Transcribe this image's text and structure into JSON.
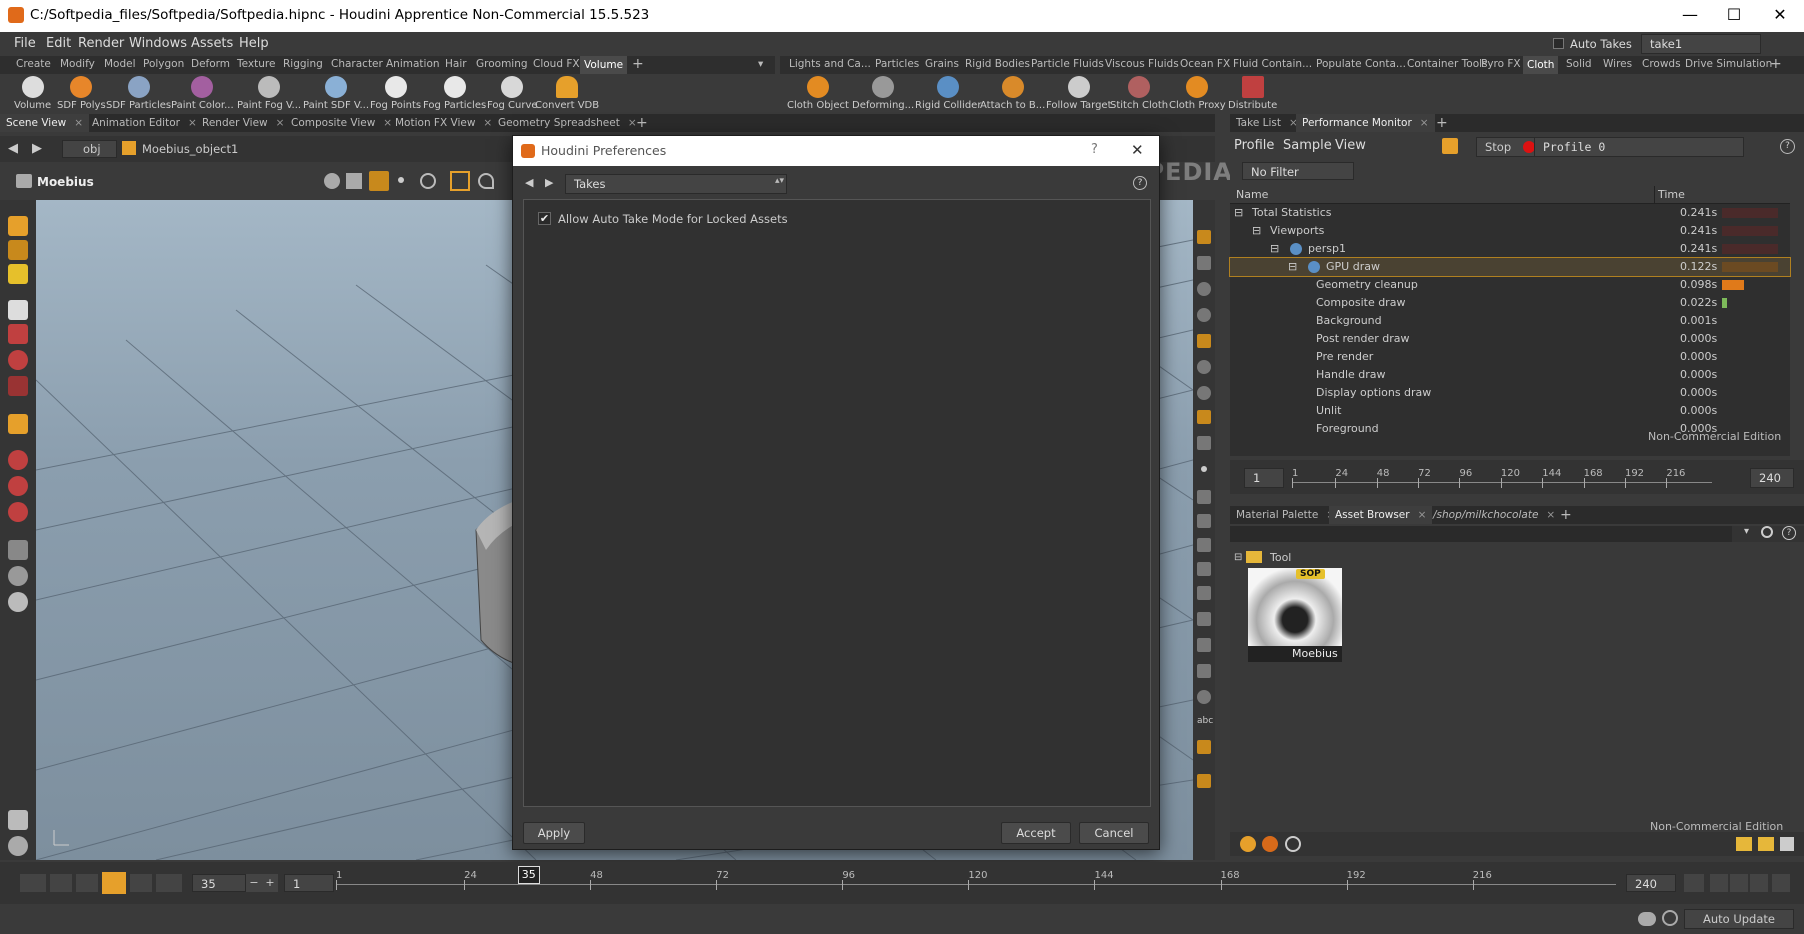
{
  "window": {
    "title": "C:/Softpedia_files/Softpedia/Softpedia.hipnc - Houdini Apprentice Non-Commercial 15.5.523",
    "min": "—",
    "max": "☐",
    "close": "✕"
  },
  "menu": [
    "File",
    "Edit",
    "Render",
    "Windows",
    "Assets",
    "Help"
  ],
  "auto_takes": {
    "label": "Auto Takes",
    "take": "take1"
  },
  "shelf_left_tabs": [
    "Create",
    "Modify",
    "Model",
    "Polygon",
    "Deform",
    "Texture",
    "Rigging",
    "Character",
    "Animation",
    "Hair",
    "Grooming",
    "Cloud FX",
    "Volume"
  ],
  "shelf_left_active": "Volume",
  "shelf_left_tools": [
    "Volume",
    "SDF Polys",
    "SDF Particles",
    "Paint Color...",
    "Paint Fog V...",
    "Paint SDF V...",
    "Fog Points",
    "Fog Particles",
    "Fog Curve",
    "Convert VDB"
  ],
  "shelf_right_tabs": [
    "Lights and Ca...",
    "Particles",
    "Grains",
    "Rigid Bodies",
    "Particle Fluids",
    "Viscous Fluids",
    "Ocean FX",
    "Fluid Contain...",
    "Populate Conta...",
    "Container Tools",
    "Pyro FX",
    "Cloth",
    "Solid",
    "Wires",
    "Crowds",
    "Drive Simulation"
  ],
  "shelf_right_active": "Cloth",
  "shelf_right_tools": [
    "Cloth Object",
    "Deforming...",
    "Rigid Collider",
    "Attach to B...",
    "Follow Target",
    "Stitch Cloth",
    "Cloth Proxy",
    "Distribute"
  ],
  "view_tabs": [
    "Scene View",
    "Animation Editor",
    "Render View",
    "Composite View",
    "Motion FX View",
    "Geometry Spreadsheet"
  ],
  "path": {
    "obj": "obj",
    "node": "Moebius_object1"
  },
  "viewport_label": "Moebius",
  "dialog": {
    "title": "Houdini Preferences",
    "help": "?",
    "close": "✕",
    "section": "Takes",
    "option": "Allow Auto Take Mode for Locked Assets",
    "apply": "Apply",
    "accept": "Accept",
    "cancel": "Cancel"
  },
  "right_tabs": [
    "Take List",
    "Performance Monitor"
  ],
  "perf": {
    "menus": [
      "Profile",
      "Sample",
      "View"
    ],
    "stop": "Stop",
    "profile": "Profile 0",
    "filter": "No Filter",
    "col_name": "Name",
    "col_time": "Time",
    "rows": [
      {
        "name": "Total Statistics",
        "time": "0.241s",
        "indent": 0,
        "bar": 0
      },
      {
        "name": "Viewports",
        "time": "0.241s",
        "indent": 1,
        "bar": 0
      },
      {
        "name": "persp1",
        "time": "0.241s",
        "indent": 2,
        "bar": 0
      },
      {
        "name": "GPU draw",
        "time": "0.122s",
        "indent": 3,
        "bar": 0,
        "sel": true
      },
      {
        "name": "Geometry cleanup",
        "time": "0.098s",
        "indent": 4,
        "bar": 0.4
      },
      {
        "name": "Composite draw",
        "time": "0.022s",
        "indent": 4,
        "bar": 0.09
      },
      {
        "name": "Background",
        "time": "0.001s",
        "indent": 4,
        "bar": 0
      },
      {
        "name": "Post render draw",
        "time": "0.000s",
        "indent": 4,
        "bar": 0
      },
      {
        "name": "Pre render",
        "time": "0.000s",
        "indent": 4,
        "bar": 0
      },
      {
        "name": "Handle draw",
        "time": "0.000s",
        "indent": 4,
        "bar": 0
      },
      {
        "name": "Display options draw",
        "time": "0.000s",
        "indent": 4,
        "bar": 0
      },
      {
        "name": "Unlit",
        "time": "0.000s",
        "indent": 4,
        "bar": 0
      },
      {
        "name": "Foreground",
        "time": "0.000s",
        "indent": 4,
        "bar": 0
      }
    ],
    "edition": "Non-Commercial Edition"
  },
  "mini_timeline": {
    "start": "1",
    "end": "240",
    "ticks": [
      "1",
      "24",
      "48",
      "72",
      "96",
      "120",
      "144",
      "168",
      "192",
      "216"
    ]
  },
  "asset_tabs": [
    "Material Palette",
    "Asset Browser",
    "/shop/milkchocolate"
  ],
  "asset": {
    "folder": "Tool",
    "badge": "SOP",
    "item": "Moebius",
    "edition": "Non-Commercial Edition"
  },
  "timeline": {
    "frame": "35",
    "start": "1",
    "end": "240",
    "ticks": [
      "1",
      "24",
      "48",
      "72",
      "96",
      "120",
      "144",
      "168",
      "192",
      "216"
    ],
    "current": "35",
    "current_fraction": 0.142
  },
  "status": {
    "auto_update": "Auto Update"
  },
  "watermark": "SOFTPEDIA"
}
